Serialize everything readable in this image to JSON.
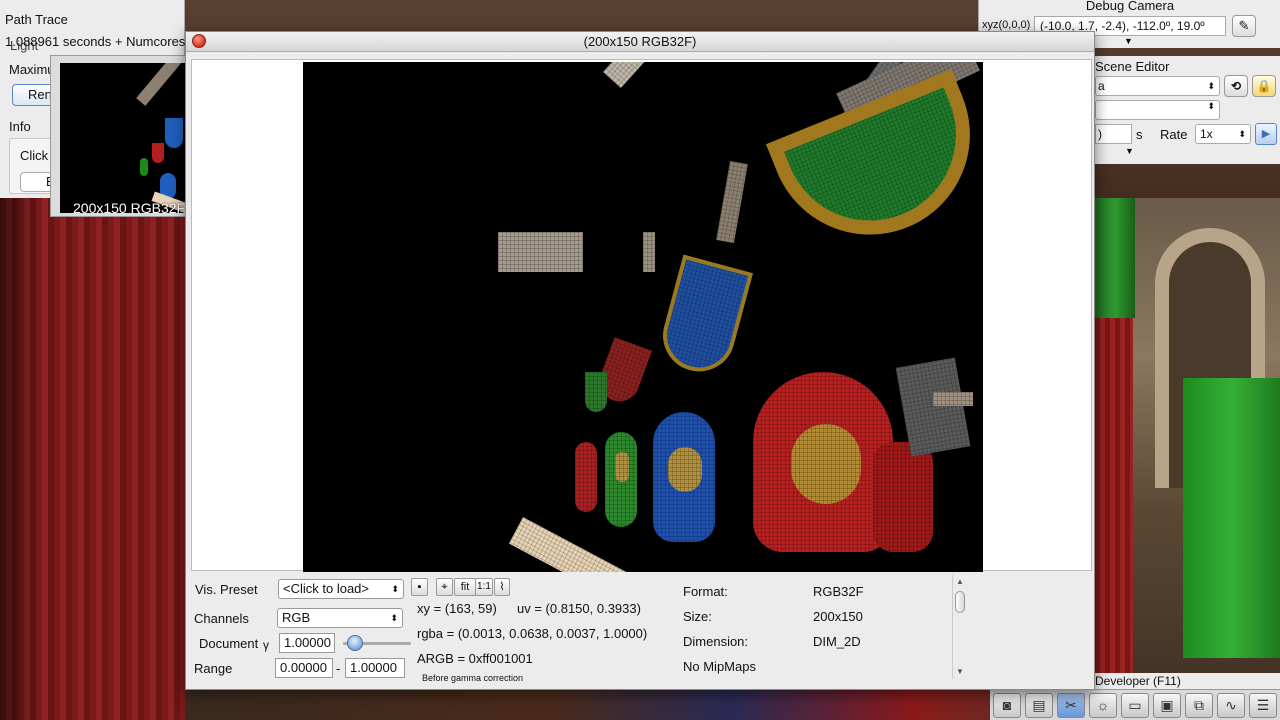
{
  "path_trace": {
    "title": "Path Trace",
    "time_text": "1.088961 seconds + Numcores",
    "light_label": "Light",
    "maximum_label": "Maximu",
    "render_button": "Ren",
    "info_label": "Info",
    "click_text": "Click",
    "small_button": "E"
  },
  "thumbnail": {
    "caption": "200x150 RGB32F"
  },
  "debug_camera": {
    "title": "Debug Camera",
    "xyz_label": "xyz(0,0,0)",
    "value": "(-10.0,   1.7,  -2.4), -112.0º,  19.0º",
    "button_icon": "pencil-icon"
  },
  "scene_editor": {
    "title": "Scene Editor",
    "scene_select": "a",
    "time_value": ")",
    "seconds_unit": "s",
    "rate_label": "Rate",
    "rate_value": "1x"
  },
  "developer": {
    "label": "Developer (F11)",
    "buttons": [
      "camera-icon",
      "film-icon",
      "tools-icon",
      "sun-icon",
      "file-new-icon",
      "terminal-icon",
      "windows-icon",
      "profiler-icon",
      "document-icon"
    ]
  },
  "viewer": {
    "title": "(200x150 RGB32F)",
    "vis_preset_label": "Vis. Preset",
    "vis_preset_value": "<Click to load>",
    "channels_label": "Channels",
    "channels_value": "RGB",
    "document_label": "Document",
    "gamma_symbol": "γ",
    "gamma_value": "1.00000",
    "range_label": "Range",
    "range_min": "0.00000",
    "range_dash": "-",
    "range_max": "1.00000",
    "tool_fit": "fit",
    "tool_1to1": "1:1",
    "xy_text": "xy =  (163, 59)",
    "uv_text": "uv =  (0.8150, 0.3933)",
    "rgba_text": "rgba =  (0.0013, 0.0638, 0.0037, 1.0000)",
    "argb_text": "ARGB =  0xff001001",
    "gamma_note": "Before gamma correction",
    "format_label": "Format:",
    "format_value": "RGB32F",
    "size_label": "Size:",
    "size_value": "200x150",
    "dimension_label": "Dimension:",
    "dimension_value": "DIM_2D",
    "mipmaps_text": "No MipMaps"
  }
}
